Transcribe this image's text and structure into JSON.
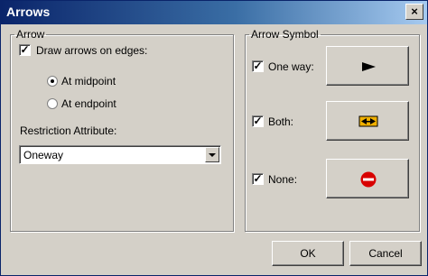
{
  "window": {
    "title": "Arrows",
    "close_label": "×"
  },
  "arrow_group": {
    "legend": "Arrow",
    "draw_arrows_label": "Draw arrows on edges:",
    "draw_arrows_checked": true,
    "at_midpoint_label": "At midpoint",
    "at_midpoint_selected": true,
    "at_endpoint_label": "At endpoint",
    "restriction_label": "Restriction Attribute:",
    "restriction_value": "Oneway"
  },
  "symbol_group": {
    "legend": "Arrow Symbol",
    "one_way_label": "One way:",
    "both_label": "Both:",
    "none_label": "None:",
    "one_way_checked": true,
    "both_checked": true,
    "none_checked": true
  },
  "buttons": {
    "ok": "OK",
    "cancel": "Cancel"
  },
  "colors": {
    "title_start": "#0a246a",
    "title_end": "#a6caf0",
    "face": "#d4d0c8"
  }
}
